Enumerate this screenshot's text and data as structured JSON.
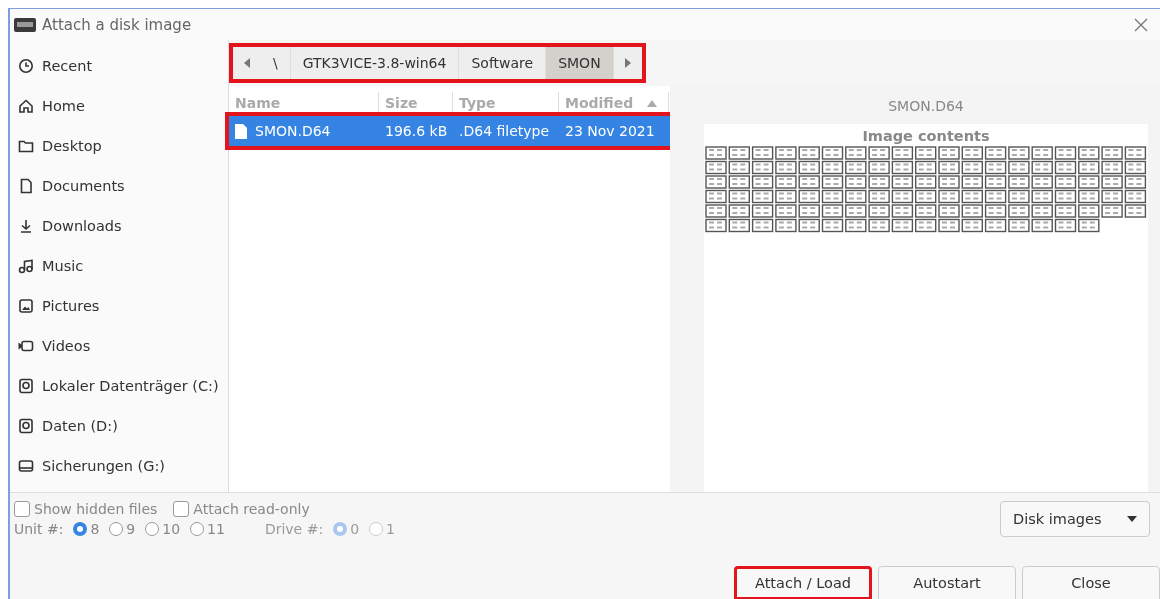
{
  "window": {
    "title": "Attach a disk image"
  },
  "sidebar": {
    "items": [
      {
        "label": "Recent",
        "kind": "recent"
      },
      {
        "label": "Home",
        "kind": "home"
      },
      {
        "label": "Desktop",
        "kind": "folder"
      },
      {
        "label": "Documents",
        "kind": "document"
      },
      {
        "label": "Downloads",
        "kind": "download"
      },
      {
        "label": "Music",
        "kind": "music"
      },
      {
        "label": "Pictures",
        "kind": "pictures"
      },
      {
        "label": "Videos",
        "kind": "videos"
      },
      {
        "label": "Lokaler Datenträger (C:)",
        "kind": "drive"
      },
      {
        "label": "Daten (D:)",
        "kind": "drive"
      },
      {
        "label": "Sicherungen (G:)",
        "kind": "disk"
      }
    ]
  },
  "pathbar": {
    "highlighted": true,
    "segments": [
      {
        "label": "\\",
        "selected": false
      },
      {
        "label": "GTK3VICE-3.8-win64",
        "selected": false
      },
      {
        "label": "Software",
        "selected": false
      },
      {
        "label": "SMON",
        "selected": true
      }
    ]
  },
  "file_list": {
    "columns": [
      {
        "label": "Name",
        "sorted": false
      },
      {
        "label": "Size",
        "sorted": false
      },
      {
        "label": "Type",
        "sorted": false
      },
      {
        "label": "Modified",
        "sorted": true
      }
    ],
    "rows": [
      {
        "cells": [
          "SMON.D64",
          "196.6 kB",
          ".D64 filetype",
          "23 Nov 2021"
        ],
        "selected": true,
        "highlighted": true
      }
    ]
  },
  "preview": {
    "filename": "SMON.D64",
    "heading": "Image contents"
  },
  "options": {
    "checkboxes": [
      {
        "label": "Show hidden files",
        "checked": false
      },
      {
        "label": "Attach read-only",
        "checked": false
      }
    ],
    "radio_groups": [
      {
        "label": "Unit #:",
        "disabled": false,
        "options": [
          {
            "label": "8",
            "selected": true
          },
          {
            "label": "9",
            "selected": false
          },
          {
            "label": "10",
            "selected": false
          },
          {
            "label": "11",
            "selected": false
          }
        ]
      },
      {
        "label": "Drive #:",
        "disabled": true,
        "options": [
          {
            "label": "0",
            "selected": true
          },
          {
            "label": "1",
            "selected": false
          }
        ]
      }
    ],
    "filter": {
      "value": "Disk images"
    }
  },
  "buttons": [
    {
      "label": "Attach / Load",
      "highlighted": true
    },
    {
      "label": "Autostart",
      "highlighted": false
    },
    {
      "label": "Close",
      "highlighted": false
    }
  ]
}
